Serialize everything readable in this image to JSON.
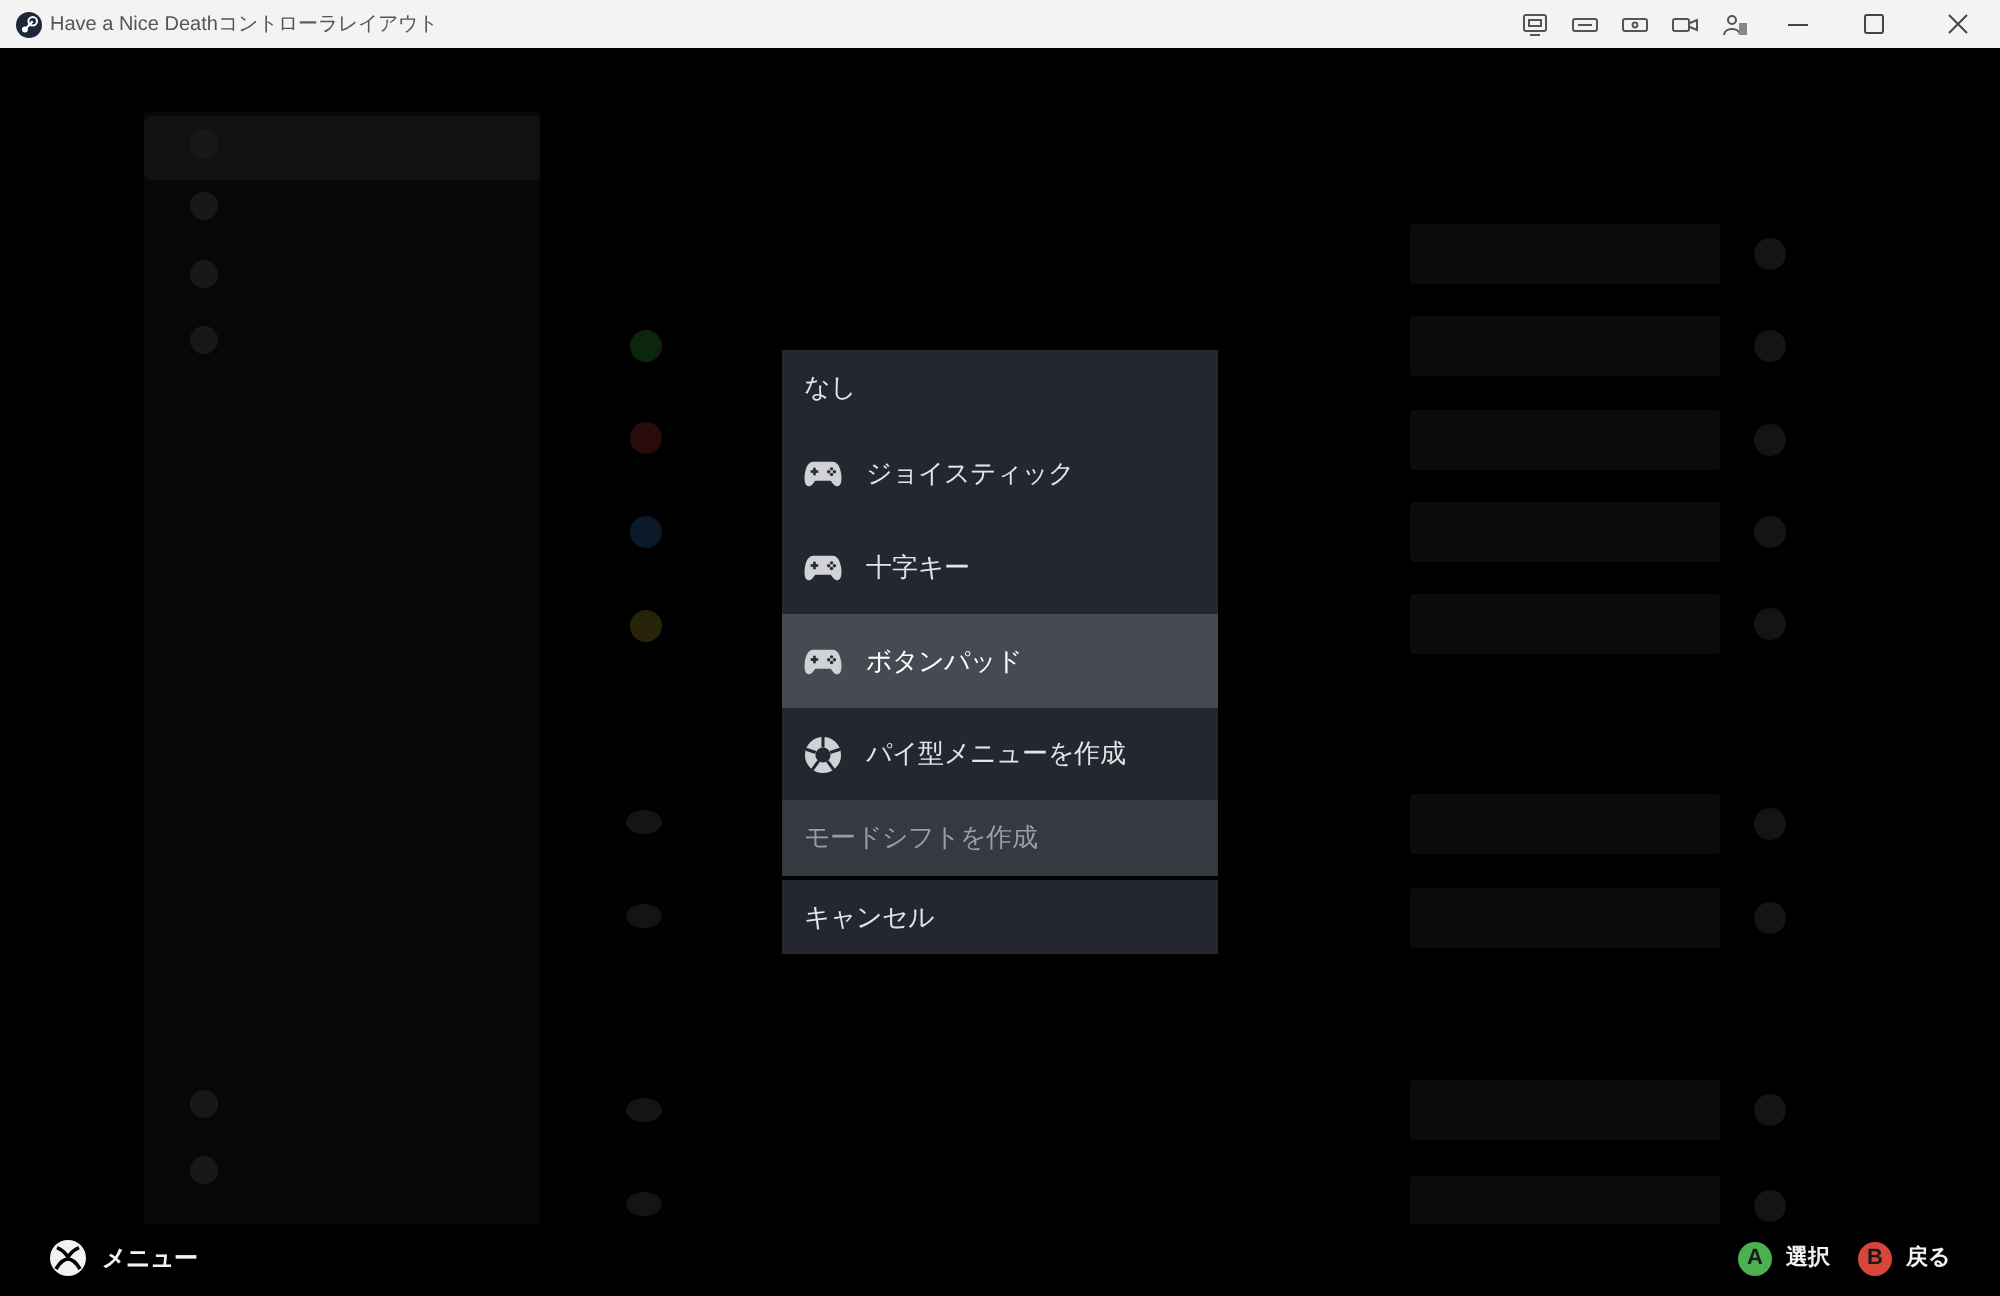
{
  "window": {
    "title": "Have a Nice Deathコントローラレイアウト"
  },
  "menu": {
    "items": [
      {
        "kind": "plain",
        "label": "なし",
        "selected": false,
        "disabled": false
      },
      {
        "kind": "gamepad",
        "label": "ジョイスティック",
        "selected": false,
        "disabled": false
      },
      {
        "kind": "gamepad",
        "label": "十字キー",
        "selected": false,
        "disabled": false
      },
      {
        "kind": "gamepad",
        "label": "ボタンパッド",
        "selected": true,
        "disabled": false
      },
      {
        "kind": "pie",
        "label": "パイ型メニューを作成",
        "selected": false,
        "disabled": false
      },
      {
        "kind": "plain",
        "label": "モードシフトを作成",
        "selected": false,
        "disabled": true
      },
      {
        "kind": "cancel",
        "label": "キャンセル",
        "selected": false,
        "disabled": false
      }
    ]
  },
  "footer": {
    "menu_hint": {
      "label": "メニュー"
    },
    "hints": [
      {
        "key": "A",
        "label": "選択",
        "color": "#4caf50"
      },
      {
        "key": "B",
        "label": "戻る",
        "color": "#d8453b"
      }
    ]
  }
}
